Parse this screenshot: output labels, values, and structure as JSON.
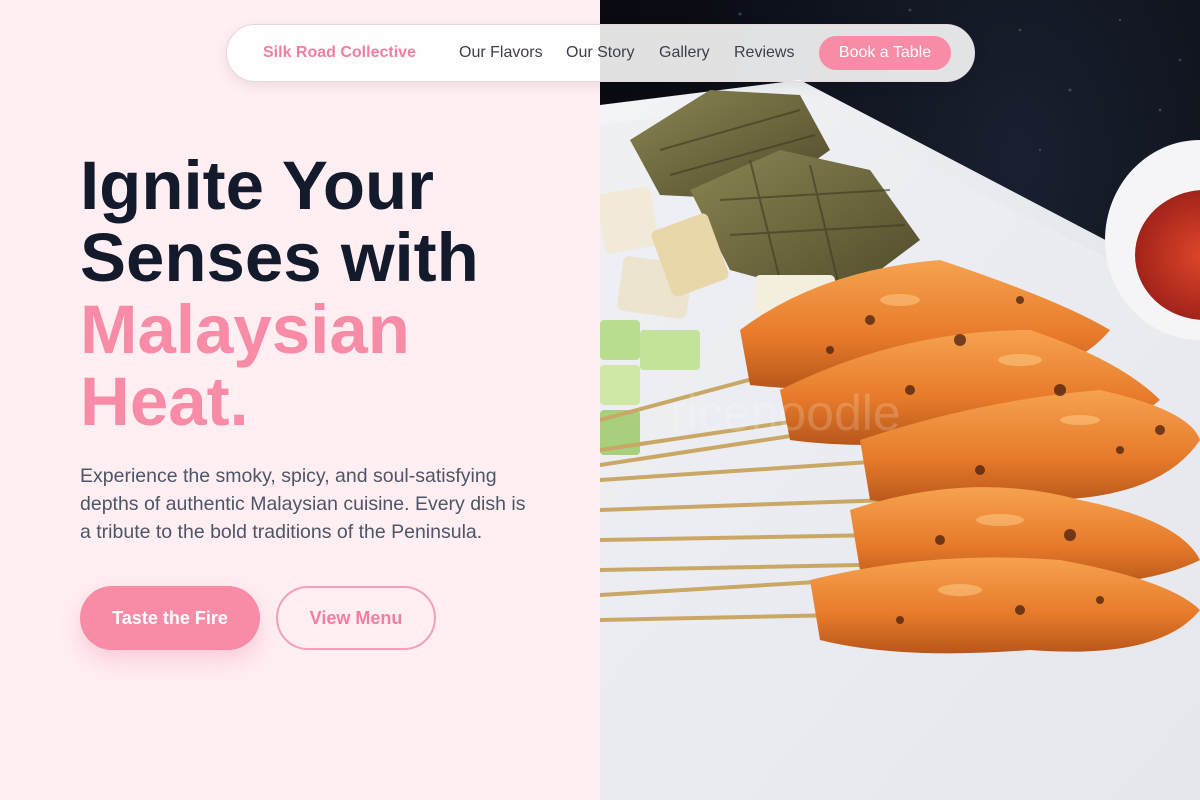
{
  "nav": {
    "brand": "Silk Road Collective",
    "links": [
      "Our Flavors",
      "Our Story",
      "Gallery",
      "Reviews"
    ],
    "cta": "Book a Table"
  },
  "hero": {
    "headline_line1": "Ignite Your",
    "headline_line2": "Senses with",
    "headline_accent1": "Malaysian",
    "headline_accent2": "Heat.",
    "description": "Experience the smoky, spicy, and soul-satisfying depths of authentic Malaysian cuisine. Every dish is a tribute to the bold traditions of the Peninsula.",
    "primary_button": "Taste the Fire",
    "secondary_button": "View Menu"
  },
  "image": {
    "watermark": "ricenoodle"
  },
  "colors": {
    "accent": "#f88ba6",
    "background": "#ffeef2",
    "heading": "#121a2b"
  }
}
